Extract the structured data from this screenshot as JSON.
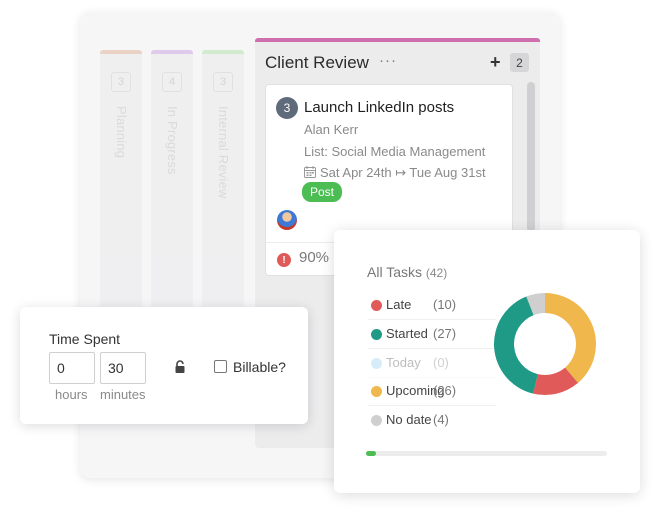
{
  "board": {
    "collapsed_columns": [
      {
        "label": "Planning",
        "count": "3",
        "color": "#e6c5b0"
      },
      {
        "label": "In Progress",
        "count": "4",
        "color": "#d7b8e8"
      },
      {
        "label": "Internal Review",
        "count": "3",
        "color": "#c4e6bd"
      }
    ],
    "main_column": {
      "title": "Client Review",
      "more": "···",
      "add": "+",
      "count": "2",
      "accent_color": "#cf6fae",
      "card": {
        "number": "3",
        "title": "Launch LinkedIn posts",
        "assignee": "Alan Kerr",
        "list": "List: Social Media Management",
        "dates": "Sat Apr 24th ↦ Tue Aug 31st",
        "tag": "Post",
        "tag_color": "#4bbd53",
        "warning_icon": "!",
        "progress": "90%"
      }
    }
  },
  "time_spent": {
    "title": "Time Spent",
    "hours_value": "0",
    "hours_label": "hours",
    "minutes_value": "30",
    "minutes_label": "minutes",
    "billable_label": "Billable?",
    "billable_checked": false
  },
  "stats": {
    "title": "All Tasks",
    "total": "(42)",
    "legend": [
      {
        "label": "Late",
        "value": "(10)",
        "color": "#e05a5a",
        "faded": false
      },
      {
        "label": "Started",
        "value": "(27)",
        "color": "#1e9a86",
        "faded": false
      },
      {
        "label": "Today",
        "value": "(0)",
        "color": "#8ec9f0",
        "faded": true
      },
      {
        "label": "Upcoming",
        "value": "(26)",
        "color": "#f0b74c",
        "faded": false
      },
      {
        "label": "No date",
        "value": "(4)",
        "color": "#cfcfcf",
        "faded": false
      }
    ],
    "progress_fraction": 0.04,
    "progress_color": "#4bbd53"
  },
  "chart_data": {
    "type": "pie",
    "title": "All Tasks",
    "categories": [
      "Late",
      "Started",
      "Today",
      "Upcoming",
      "No date"
    ],
    "values": [
      10,
      27,
      0,
      26,
      4
    ],
    "colors": [
      "#e05a5a",
      "#1e9a86",
      "#8ec9f0",
      "#f0b74c",
      "#cfcfcf"
    ],
    "donut": true
  }
}
